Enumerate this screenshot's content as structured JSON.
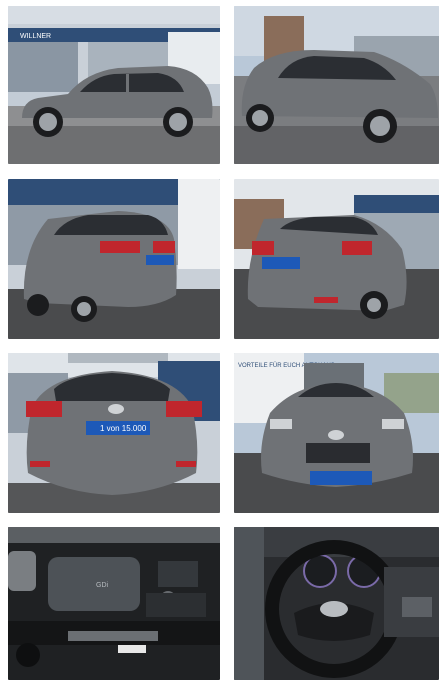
{
  "gallery": {
    "photos": [
      {
        "name": "front-left-side"
      },
      {
        "name": "front-right-side"
      },
      {
        "name": "rear-left"
      },
      {
        "name": "rear-right"
      },
      {
        "name": "rear"
      },
      {
        "name": "front"
      },
      {
        "name": "engine-bay"
      },
      {
        "name": "steering-wheel-dashboard"
      }
    ],
    "plate_text": "1 von 15.000",
    "banner_text": "VORTEILE FÜR EUCH AUTOHAUS",
    "dealer_sign": "WILLNER",
    "engine_badge": "GDi",
    "colors": {
      "car_body": "#6f7276",
      "sky": "#b9c8d8",
      "asphalt": "#4a4b4d",
      "dealer_blue": "#2f4e77",
      "plate_blue": "#1d59b8",
      "taillight": "#c0262d"
    }
  }
}
